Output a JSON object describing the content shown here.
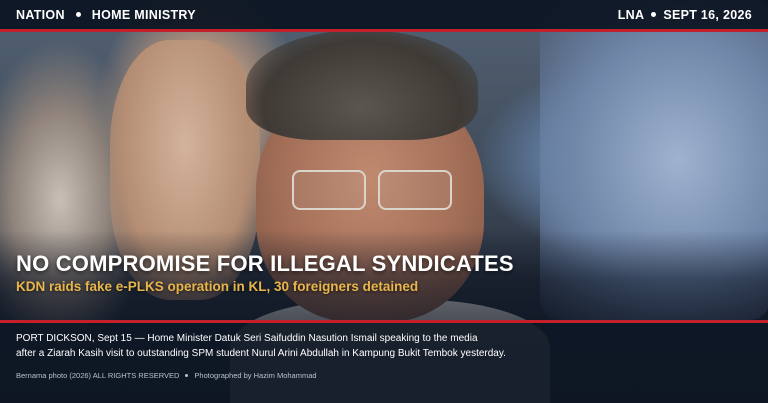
{
  "topbar": {
    "section": "NATION",
    "subsection": "HOME MINISTRY",
    "source": "LNA",
    "date": "SEPT 16, 2026"
  },
  "headline": "NO COMPROMISE FOR ILLEGAL SYNDICATES",
  "subheadline": "KDN raids fake e-PLKS operation in KL, 30 foreigners detained",
  "caption": {
    "line1": "PORT DICKSON, Sept 15 — Home Minister Datuk Seri Saifuddin Nasution Ismail speaking to the media",
    "line2": "after a Ziarah Kasih visit to outstanding SPM student Nurul Arini Abdullah in Kampung Bukit Tembok yesterday."
  },
  "credits": {
    "photo": "Bernama photo (2026) ALL RIGHTS RESERVED",
    "photographer": "Photographed by Hazim Mohammad"
  },
  "colors": {
    "accent": "#c4202b",
    "subhead": "#e8b64a",
    "panel": "#0e1624"
  }
}
